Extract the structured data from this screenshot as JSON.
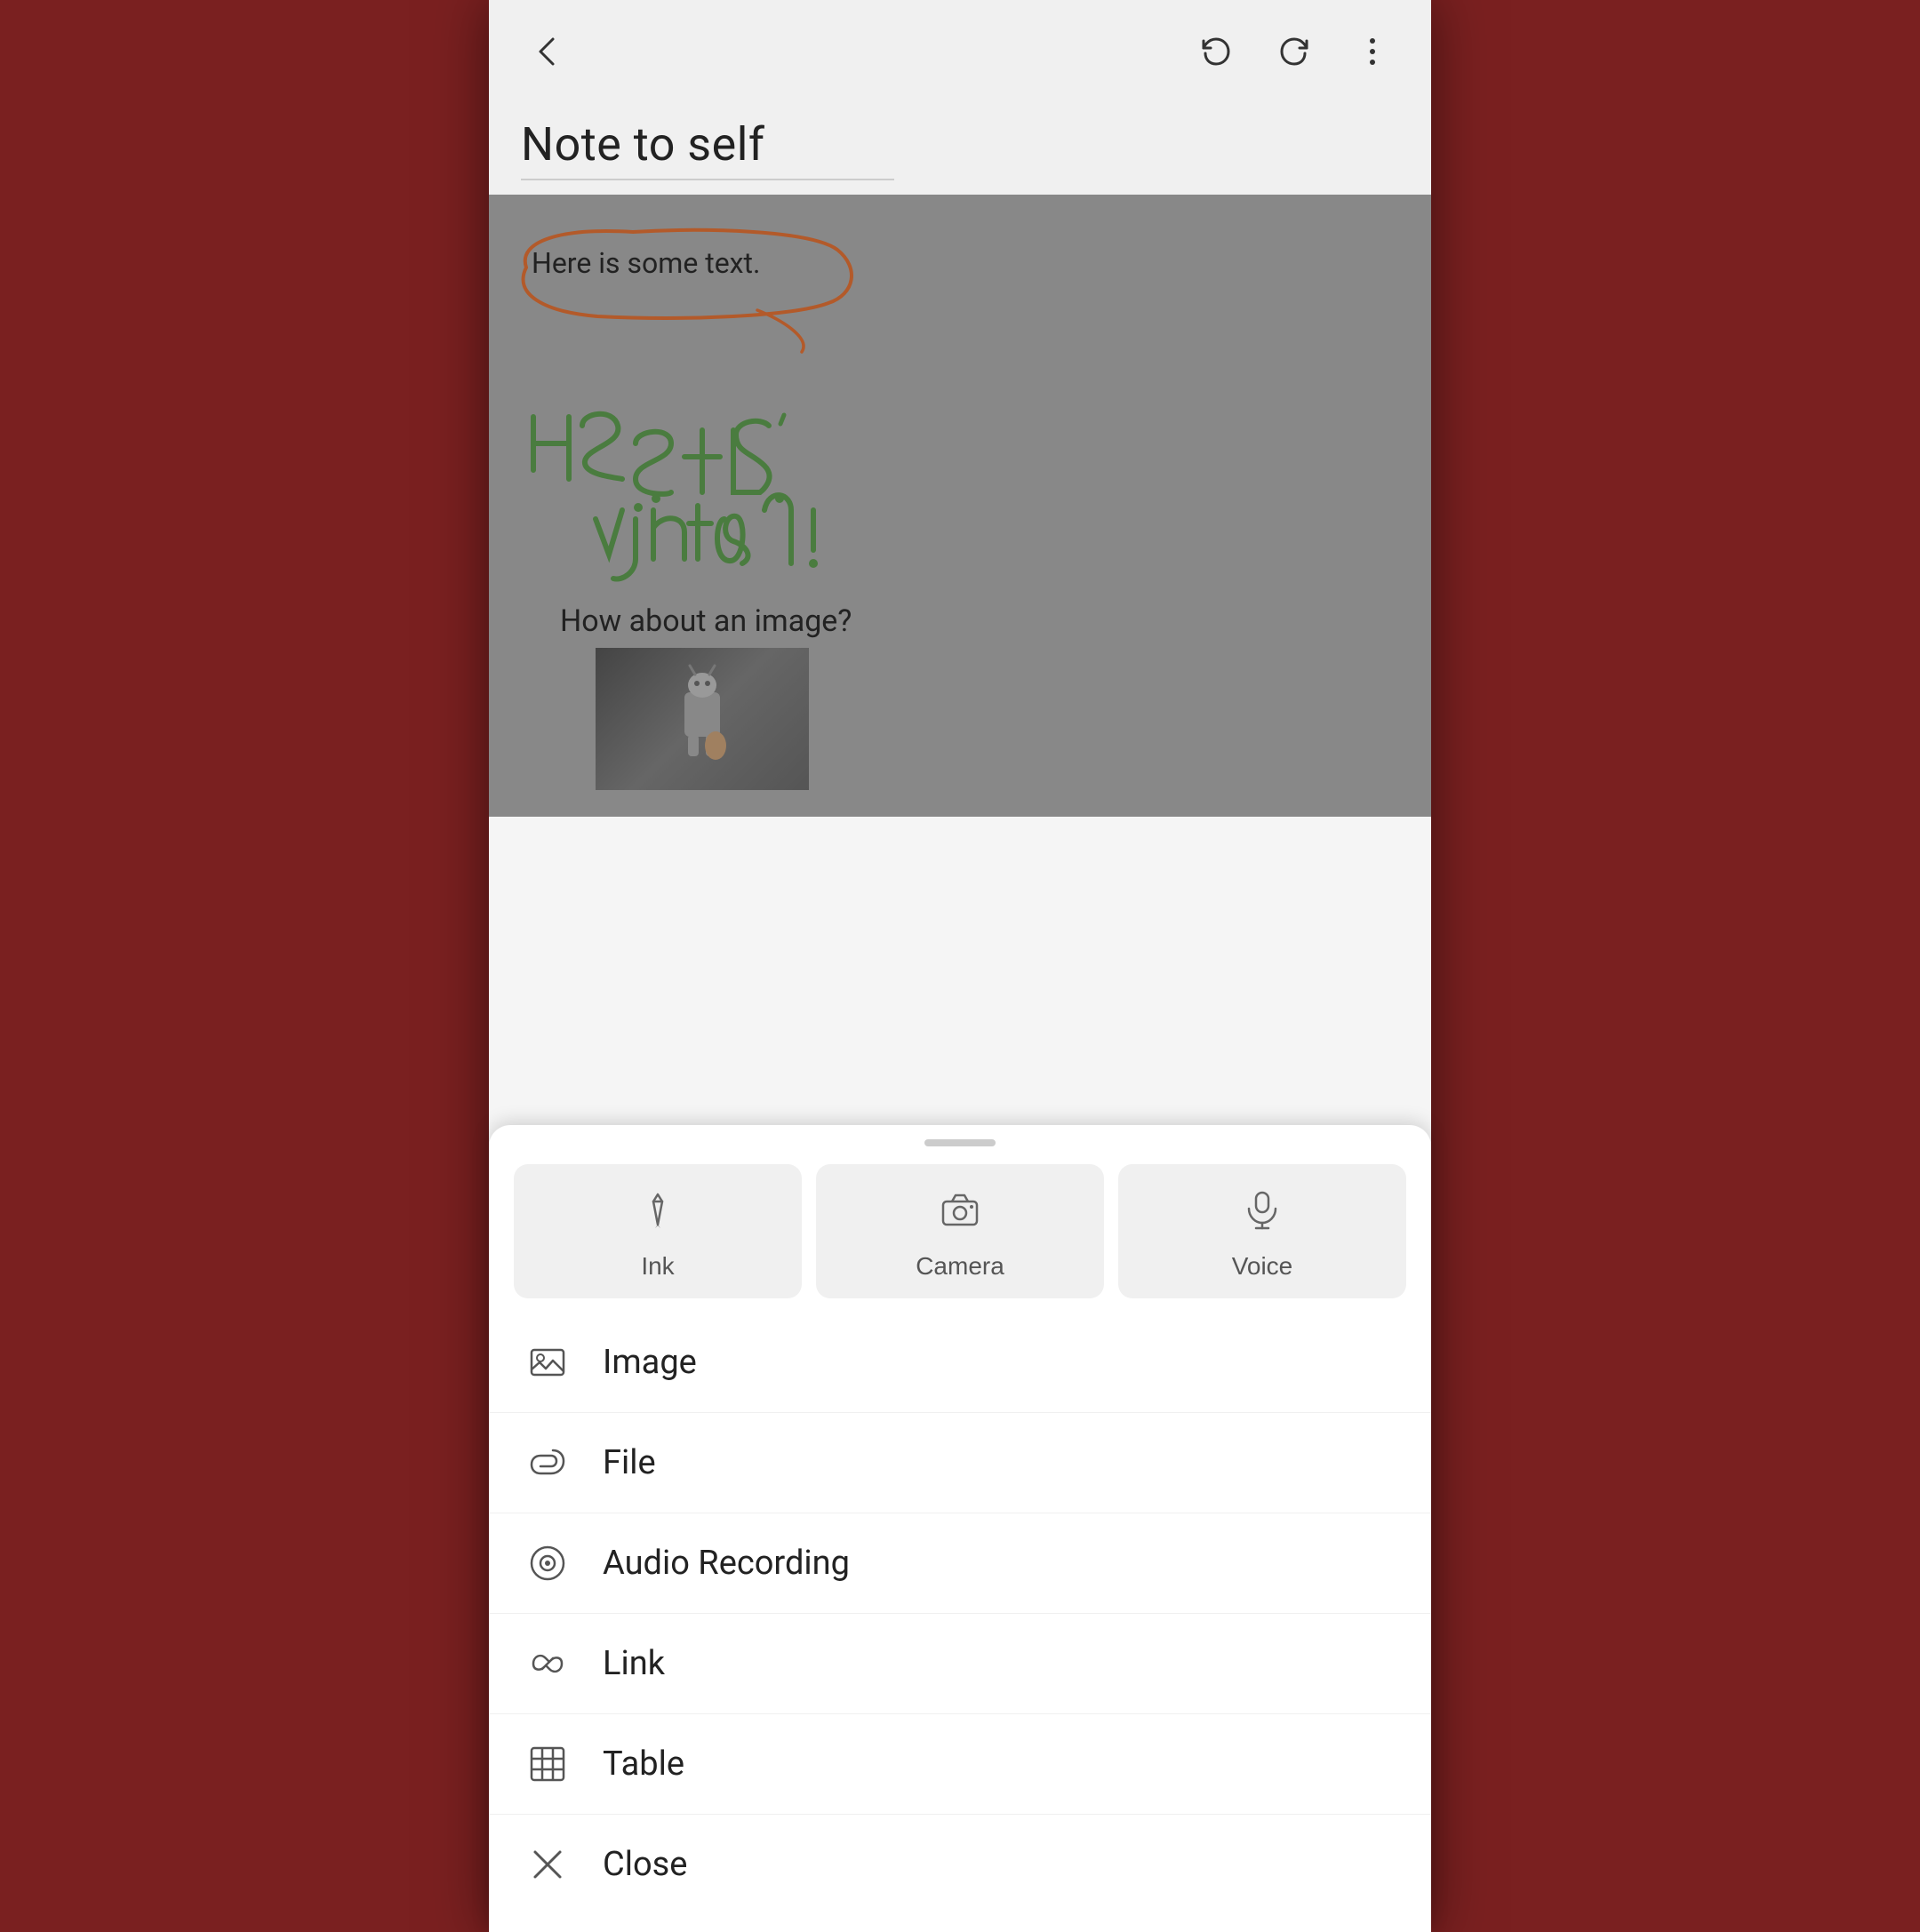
{
  "app": {
    "title": "Note to self"
  },
  "header": {
    "back_label": "back",
    "undo_label": "undo",
    "redo_label": "redo",
    "more_label": "more options"
  },
  "note": {
    "title": "Note to self",
    "typed_text": "Here is some text.",
    "image_prompt": "How about an image?"
  },
  "bottomSheet": {
    "handle_label": "sheet handle",
    "quickActions": [
      {
        "id": "ink",
        "label": "Ink",
        "icon": "ink-icon"
      },
      {
        "id": "camera",
        "label": "Camera",
        "icon": "camera-icon"
      },
      {
        "id": "voice",
        "label": "Voice",
        "icon": "voice-icon"
      }
    ],
    "menuItems": [
      {
        "id": "image",
        "label": "Image",
        "icon": "image-icon"
      },
      {
        "id": "file",
        "label": "File",
        "icon": "file-icon"
      },
      {
        "id": "audio",
        "label": "Audio Recording",
        "icon": "audio-icon"
      },
      {
        "id": "link",
        "label": "Link",
        "icon": "link-icon"
      },
      {
        "id": "table",
        "label": "Table",
        "icon": "table-icon"
      },
      {
        "id": "close",
        "label": "Close",
        "icon": "close-icon"
      }
    ]
  }
}
